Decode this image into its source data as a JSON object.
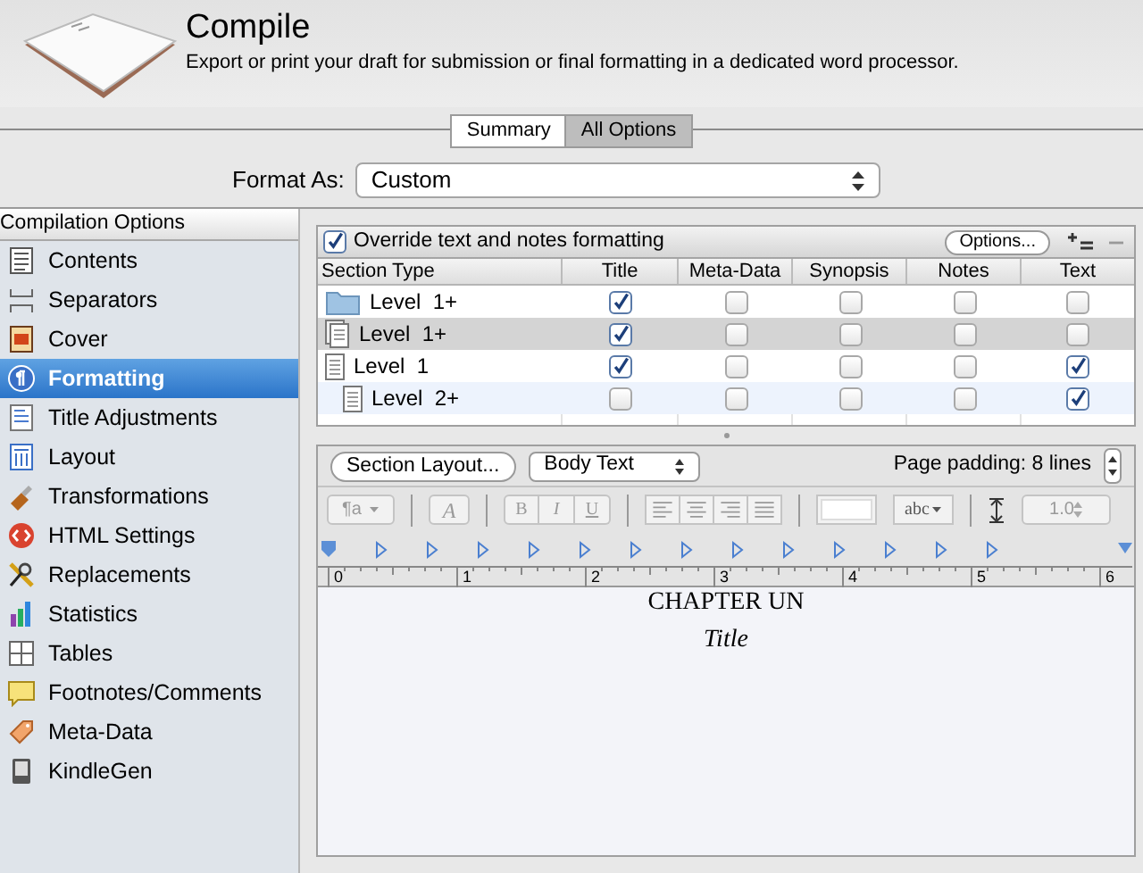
{
  "header": {
    "title": "Compile",
    "subtitle": "Export or print your draft for submission or final formatting in a dedicated word processor."
  },
  "tabs": [
    {
      "label": "Summary",
      "selected": false
    },
    {
      "label": "All Options",
      "selected": true
    }
  ],
  "format_as": {
    "label": "Format As:",
    "value": "Custom"
  },
  "sidebar": {
    "heading": "Compilation Options",
    "items": [
      {
        "label": "Contents",
        "kind": "contents",
        "selected": false
      },
      {
        "label": "Separators",
        "kind": "separators",
        "selected": false
      },
      {
        "label": "Cover",
        "kind": "cover",
        "selected": false
      },
      {
        "label": "Formatting",
        "kind": "formatting",
        "selected": true
      },
      {
        "label": "Title Adjustments",
        "kind": "title",
        "selected": false
      },
      {
        "label": "Layout",
        "kind": "layout",
        "selected": false
      },
      {
        "label": "Transformations",
        "kind": "transform",
        "selected": false
      },
      {
        "label": "HTML Settings",
        "kind": "html",
        "selected": false
      },
      {
        "label": "Replacements",
        "kind": "replace",
        "selected": false
      },
      {
        "label": "Statistics",
        "kind": "stats",
        "selected": false
      },
      {
        "label": "Tables",
        "kind": "tables",
        "selected": false
      },
      {
        "label": "Footnotes/Comments",
        "kind": "footnotes",
        "selected": false
      },
      {
        "label": "Meta-Data",
        "kind": "meta",
        "selected": false
      },
      {
        "label": "KindleGen",
        "kind": "kindle",
        "selected": false
      }
    ]
  },
  "table": {
    "override": {
      "label": "Override text and notes formatting",
      "checked": true
    },
    "options_button": "Options...",
    "columns": [
      "Section Type",
      "Title",
      "Meta-Data",
      "Synopsis",
      "Notes",
      "Text"
    ],
    "rows": [
      {
        "label": "Level  1+",
        "kind": "folder",
        "selected": false,
        "checks": [
          true,
          false,
          false,
          false,
          false
        ]
      },
      {
        "label": "Level  1+",
        "kind": "stack",
        "selected": true,
        "checks": [
          true,
          false,
          false,
          false,
          false
        ]
      },
      {
        "label": "Level  1",
        "kind": "page",
        "selected": false,
        "checks": [
          true,
          false,
          false,
          false,
          true
        ],
        "children": [
          {
            "label": "Level  2+",
            "kind": "page",
            "selected": false,
            "checks": [
              false,
              false,
              false,
              false,
              true
            ]
          }
        ]
      }
    ]
  },
  "editor": {
    "section_layout_button": "Section Layout...",
    "style_select": "Body Text",
    "padding_label": "Page padding: 8 lines",
    "toolbar": {
      "paragraph": "¶a",
      "font": "A",
      "bold": "B",
      "italic": "I",
      "underline": "U",
      "highlight": "abc",
      "line_spacing": "1.0"
    },
    "ruler": [
      "0",
      "1",
      "2",
      "3",
      "4",
      "5",
      "6"
    ],
    "chapter": "CHAPTER UN",
    "title": "Title"
  }
}
